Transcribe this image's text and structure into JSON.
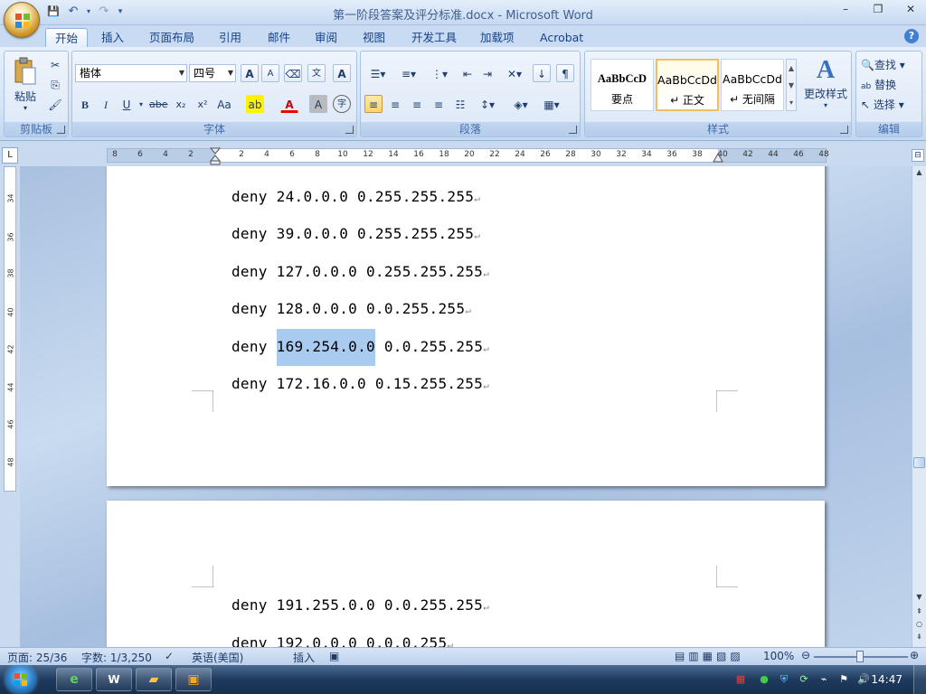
{
  "window": {
    "title": "第一阶段答案及评分标准.docx - Microsoft Word",
    "minimize": "–",
    "restore": "❐",
    "close": "✕"
  },
  "qat": {
    "save": "💾",
    "undo": "↶",
    "redo": "↷",
    "customize": "▾"
  },
  "tabs": [
    {
      "label": "开始",
      "active": true
    },
    {
      "label": "插入"
    },
    {
      "label": "页面布局"
    },
    {
      "label": "引用"
    },
    {
      "label": "邮件"
    },
    {
      "label": "审阅"
    },
    {
      "label": "视图"
    },
    {
      "label": "开发工具"
    },
    {
      "label": "加载项"
    },
    {
      "label": "Acrobat"
    }
  ],
  "help": "?",
  "ribbon": {
    "clipboard": {
      "paste_label": "粘贴",
      "group_label": "剪贴板"
    },
    "font": {
      "font_name": "楷体",
      "font_size": "四号",
      "grow": "A",
      "shrink": "A",
      "bold": "B",
      "italic": "I",
      "underline": "U",
      "strike": "abe",
      "subscript": "x₂",
      "superscript": "x²",
      "change_case": "Aa",
      "font_color": "A",
      "char_shading": "A",
      "enclose": "字",
      "phonetic": "文",
      "group_label": "字体"
    },
    "paragraph": {
      "group_label": "段落"
    },
    "styles": {
      "items": [
        {
          "sample": "AaBbCcD",
          "name": "要点"
        },
        {
          "sample": "AaBbCcDd",
          "name": "↵ 正文",
          "selected": true
        },
        {
          "sample": "AaBbCcDd",
          "name": "↵ 无间隔"
        }
      ],
      "change_styles": "更改样式",
      "group_label": "样式"
    },
    "editing": {
      "find": "查找",
      "replace": "替换",
      "select": "选择",
      "group_label": "编辑"
    }
  },
  "ruler": {
    "corner": "L",
    "ticks": [
      "8",
      "6",
      "4",
      "2",
      "2",
      "4",
      "6",
      "8",
      "10",
      "12",
      "14",
      "16",
      "18",
      "20",
      "22",
      "24",
      "26",
      "28",
      "30",
      "32",
      "34",
      "36",
      "38",
      "40",
      "42",
      "44",
      "46",
      "48"
    ],
    "vticks": [
      "34",
      "36",
      "38",
      "40",
      "42",
      "44",
      "46",
      "48"
    ]
  },
  "document": {
    "page1_lines": [
      {
        "pre": "deny 24.0.0.0 0.255.255.255",
        "sel": "",
        "post": ""
      },
      {
        "pre": "deny 39.0.0.0 0.255.255.255",
        "sel": "",
        "post": ""
      },
      {
        "pre": "deny 127.0.0.0 0.255.255.255",
        "sel": "",
        "post": ""
      },
      {
        "pre": "deny 128.0.0.0 0.0.255.255",
        "sel": "",
        "post": ""
      },
      {
        "pre": "deny ",
        "sel": "169.254.0.0",
        "post": " 0.0.255.255"
      },
      {
        "pre": "deny 172.16.0.0 0.15.255.255",
        "sel": "",
        "post": ""
      }
    ],
    "page2_lines": [
      {
        "pre": "deny 191.255.0.0 0.0.255.255",
        "sel": "",
        "post": ""
      },
      {
        "pre": "deny 192.0.0.0 0.0.0.255",
        "sel": "",
        "post": ""
      }
    ],
    "para_mark": "↵"
  },
  "status": {
    "page": "页面: 25/36",
    "words": "字数: 1/3,250",
    "language": "英语(美国)",
    "mode": "插入",
    "zoom": "100%"
  },
  "taskbar": {
    "time": "14:47"
  }
}
